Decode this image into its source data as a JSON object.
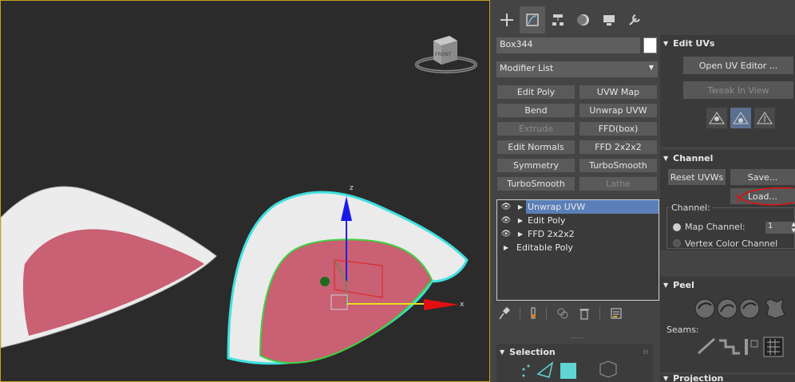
{
  "viewport": {
    "viewcube_label": "FRONT",
    "gizmo_axis_z": "z",
    "gizmo_axis_x": "x",
    "colors": {
      "border": "#c8a020",
      "mesh_inner": "#c96073",
      "selection_outline": "#3fe0e0",
      "edge_highlight": "#40d040"
    }
  },
  "command_panel": {
    "tabs": [
      "create-icon",
      "modify-icon",
      "hierarchy-icon",
      "motion-icon",
      "display-icon",
      "utilities-icon"
    ],
    "object_name": "Box344",
    "modifier_list": "Modifier List",
    "modifier_buttons": [
      {
        "label": "Edit Poly",
        "enabled": true
      },
      {
        "label": "UVW Map",
        "enabled": true
      },
      {
        "label": "Bend",
        "enabled": true
      },
      {
        "label": "Unwrap UVW",
        "enabled": true
      },
      {
        "label": "Extrude",
        "enabled": false
      },
      {
        "label": "FFD(box)",
        "enabled": true
      },
      {
        "label": "Edit Normals",
        "enabled": true
      },
      {
        "label": "FFD 2x2x2",
        "enabled": true
      },
      {
        "label": "Symmetry",
        "enabled": true
      },
      {
        "label": "TurboSmooth",
        "enabled": true
      },
      {
        "label": "TurboSmooth",
        "enabled": true
      },
      {
        "label": "Lathe",
        "enabled": false
      }
    ],
    "stack": [
      {
        "label": "Unwrap UVW",
        "eye": true,
        "selected": true
      },
      {
        "label": "Edit Poly",
        "eye": true,
        "selected": false
      },
      {
        "label": "FFD 2x2x2",
        "eye": true,
        "selected": false
      },
      {
        "label": "Editable Poly",
        "eye": false,
        "selected": false
      }
    ],
    "selection_rollout": "Selection"
  },
  "edit_uvs": {
    "title": "Edit UVs",
    "open_uv_editor": "Open UV Editor ...",
    "tweak_in_view": "Tweak In View"
  },
  "channel": {
    "title": "Channel",
    "reset_uvws": "Reset UVWs",
    "save": "Save...",
    "load": "Load...",
    "group_label": "Channel:",
    "map_channel_label": "Map Channel:",
    "map_channel_value": "1",
    "vertex_color_channel": "Vertex Color Channel"
  },
  "peel": {
    "title": "Peel",
    "seams_label": "Seams:"
  },
  "projection": {
    "title": "Projection"
  }
}
